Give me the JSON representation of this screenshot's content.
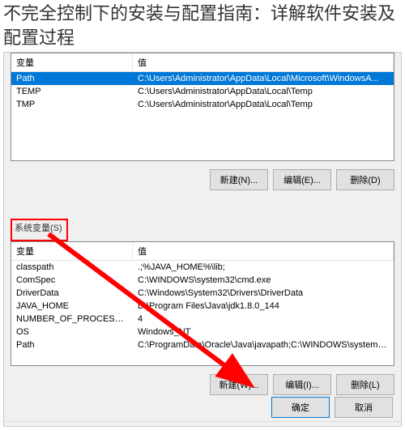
{
  "article": {
    "title": "不完全控制下的安装与配置指南：详解软件安装及配置过程"
  },
  "userVars": {
    "headers": {
      "name": "变量",
      "value": "值"
    },
    "rows": [
      {
        "name": "Path",
        "value": "C:\\Users\\Administrator\\AppData\\Local\\Microsoft\\WindowsA..."
      },
      {
        "name": "TEMP",
        "value": "C:\\Users\\Administrator\\AppData\\Local\\Temp"
      },
      {
        "name": "TMP",
        "value": "C:\\Users\\Administrator\\AppData\\Local\\Temp"
      }
    ],
    "buttons": {
      "new": "新建(N)...",
      "edit": "编辑(E)...",
      "delete": "删除(D)"
    }
  },
  "sysVars": {
    "groupLabel": "系统变量(S)",
    "headers": {
      "name": "变量",
      "value": "值"
    },
    "rows": [
      {
        "name": "classpath",
        "value": ".;%JAVA_HOME%\\lib;"
      },
      {
        "name": "ComSpec",
        "value": "C:\\WINDOWS\\system32\\cmd.exe"
      },
      {
        "name": "DriverData",
        "value": "C:\\Windows\\System32\\Drivers\\DriverData"
      },
      {
        "name": "JAVA_HOME",
        "value": "D:\\Program Files\\Java\\jdk1.8.0_144"
      },
      {
        "name": "NUMBER_OF_PROCESSORS",
        "value": "4"
      },
      {
        "name": "OS",
        "value": "Windows_NT"
      },
      {
        "name": "Path",
        "value": "C:\\ProgramData\\Oracle\\Java\\javapath;C:\\WINDOWS\\system3..."
      }
    ],
    "buttons": {
      "new": "新建(W)...",
      "edit": "编辑(I)...",
      "delete": "删除(L)"
    }
  },
  "dialog": {
    "ok": "确定",
    "cancel": "取消"
  },
  "annotations": {
    "highlightColor": "#ff0000"
  }
}
